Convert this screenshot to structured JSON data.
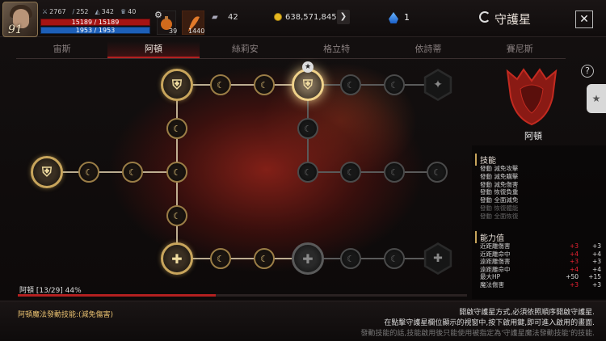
{
  "player": {
    "level": "91",
    "stat1": "2767",
    "stat2": "252",
    "stat3": "342",
    "stat4": "40",
    "hp": "15189 / 15189",
    "mp": "1953 / 1953",
    "potion1_count": "39",
    "potion2_count": "1440"
  },
  "currency": {
    "wings": "42",
    "gold": "638,571,845",
    "crystal": "1"
  },
  "header": {
    "title": "守護星"
  },
  "tabs": [
    "宙斯",
    "阿頓",
    "絲莉安",
    "格立特",
    "依詩蒂",
    "賽尼斯"
  ],
  "active_tab": 1,
  "constellation": {
    "name": "阿頓"
  },
  "skills_title": "技能",
  "skills": [
    "發動 減免攻擊",
    "發動 減免購擊",
    "發動 減免傷害",
    "發動 恢復負重",
    "發動 全面減免",
    "發動 恢復體能",
    "發動 全面恢復"
  ],
  "abilities_title": "能力值",
  "abilities": [
    {
      "name": "近距離傷害",
      "v1": "+3",
      "v2": "+3",
      "red": true
    },
    {
      "name": "近距離命中",
      "v1": "+4",
      "v2": "+4",
      "red": true
    },
    {
      "name": "遠距離傷害",
      "v1": "+3",
      "v2": "+3",
      "red": true
    },
    {
      "name": "遠距離命中",
      "v1": "+4",
      "v2": "+4",
      "red": true
    },
    {
      "name": "最大HP",
      "v1": "+50",
      "v2": "+15",
      "red": false
    },
    {
      "name": "魔法傷害",
      "v1": "+3",
      "v2": "+3",
      "red": true
    }
  ],
  "progress": {
    "label": "阿頓 [13/29] 44%",
    "percent": 44
  },
  "footer": {
    "magic_skill": "阿頓魔法發動技能:(減免傷害)",
    "help1": "開啟守護星方式,必須依照順序開啟守護星.",
    "help2": "在點擊守護星欄位顯示的視窗中,按下啟用鍵,即可進入啟用的畫面.",
    "help3": "發動技能的話,技能啟用後只能使用被指定為'守護星魔法發動技能'的技能."
  },
  "colors": {
    "accent": "#b32020",
    "gold": "#c8a55c",
    "hp": "#a51414",
    "mp": "#1d5fb8"
  }
}
